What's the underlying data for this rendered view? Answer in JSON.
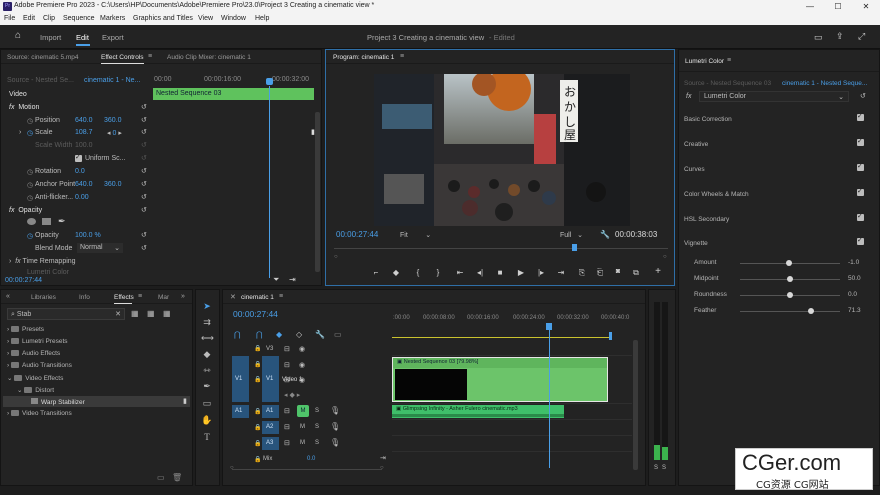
{
  "window": {
    "title": "Adobe Premiere Pro 2023 - C:\\Users\\HP\\Documents\\Adobe\\Premiere Pro\\23.0\\Project 3 Creating a cinematic view *",
    "logo": "Pr",
    "controls": [
      "—",
      "☐",
      "✕"
    ]
  },
  "menu": [
    "File",
    "Edit",
    "Clip",
    "Sequence",
    "Markers",
    "Graphics and Titles",
    "View",
    "Window",
    "Help"
  ],
  "workspace": {
    "tabs": [
      "Import",
      "Edit",
      "Export"
    ],
    "active": "Edit",
    "project_title": "Project 3 Creating a cinematic view",
    "edited": "- Edited"
  },
  "effect_controls": {
    "tabs": [
      "Source: cinematic 5.mp4",
      "Effect Controls",
      "Audio Clip Mixer: cinematic 1"
    ],
    "source_label": "Source - Nested Se...",
    "sequence_label": "cinematic 1 - Ne...",
    "times": [
      "00:00",
      "00:00:16:00",
      "00:00:32:00"
    ],
    "clip_name": "Nested Sequence 03",
    "section": "Video",
    "motion": "Motion",
    "position_label": "Position",
    "position_x": "640.0",
    "position_y": "360.0",
    "scale_label": "Scale",
    "scale_value": "108.7",
    "scale_kf": "0",
    "scale_width_label": "Scale Width",
    "scale_width_value": "100.0",
    "uniform_scale": "Uniform Sc...",
    "rotation_label": "Rotation",
    "rotation_value": "0.0",
    "anchor_label": "Anchor Point",
    "anchor_x": "640.0",
    "anchor_y": "360.0",
    "antiflicker_label": "Anti-flicker...",
    "antiflicker_value": "0.00",
    "opacity_section": "Opacity",
    "opacity_label": "Opacity",
    "opacity_value": "100.0 %",
    "blend_label": "Blend Mode",
    "blend_value": "Normal",
    "time_remap": "Time Remapping",
    "lumetri_partial": "Lumetri Color",
    "timecode": "00:00:27:44"
  },
  "program": {
    "tab": "Program: cinematic 1",
    "timecode": "00:00:27:44",
    "fit": "Fit",
    "quality": "Full",
    "duration": "00:00:38:03",
    "sign_text": [
      "お",
      "か",
      "し",
      "屋"
    ],
    "controls": [
      "⌐",
      "◆",
      "{",
      "}",
      "⇤",
      "◂|",
      "◀",
      "▶",
      "|▸",
      "⇥",
      "⎘",
      "⎗",
      "📷",
      "⧉",
      "+"
    ]
  },
  "project_browser": {
    "tabs": [
      "Libraries",
      "Info",
      "Effects",
      "Mar"
    ],
    "active_tab": "Effects",
    "search_value": "Stab",
    "tree": [
      "Presets",
      "Lumetri Presets",
      "Audio Effects",
      "Audio Transitions",
      "Video Effects",
      "Distort",
      "Warp Stabilizer",
      "Video Transitions"
    ]
  },
  "timeline": {
    "tab": "cinematic 1",
    "timecode": "00:00:27:44",
    "ruler": [
      ":00:00",
      "00:00:08:00",
      "00:00:16:00",
      "00:00:24:00",
      "00:00:32:00",
      "00:00:40:0"
    ],
    "video_tracks": [
      "V3",
      "V2",
      "V1"
    ],
    "audio_tracks": [
      "A1",
      "A2",
      "A3"
    ],
    "video_track_name": "Video 1",
    "mix_label": "Mix",
    "mix_value": "0.0",
    "video_clip": "Nested Sequence 03 [79.98%]",
    "audio_clip": "Glimpsing Infinity - Asher Fulero cinematic.mp3",
    "m_label": "M",
    "s_label": "S"
  },
  "meter": {
    "labels": [
      "S",
      "S"
    ]
  },
  "lumetri": {
    "title": "Lumetri Color",
    "source_label": "Source - Nested Sequence 03",
    "sequence_label": "cinematic 1 - Nested Seque...",
    "effect_name": "Lumetri Color",
    "sections": [
      "Basic Correction",
      "Creative",
      "Curves",
      "Color Wheels & Match",
      "HSL Secondary",
      "Vignette"
    ],
    "vignette": [
      {
        "label": "Amount",
        "value": "-1.0",
        "level": 0.49
      },
      {
        "label": "Midpoint",
        "value": "50.0",
        "level": 0.5
      },
      {
        "label": "Roundness",
        "value": "0.0",
        "level": 0.5
      },
      {
        "label": "Feather",
        "value": "71.3",
        "level": 0.71
      }
    ]
  },
  "watermark": {
    "main": "CGer.com",
    "sub": "CG资源  CG网站"
  },
  "colors": {
    "accent": "#4a9fe8",
    "clip_green": "#5fc25d",
    "video_clip": "#6cc46a",
    "panel": "#232323"
  }
}
